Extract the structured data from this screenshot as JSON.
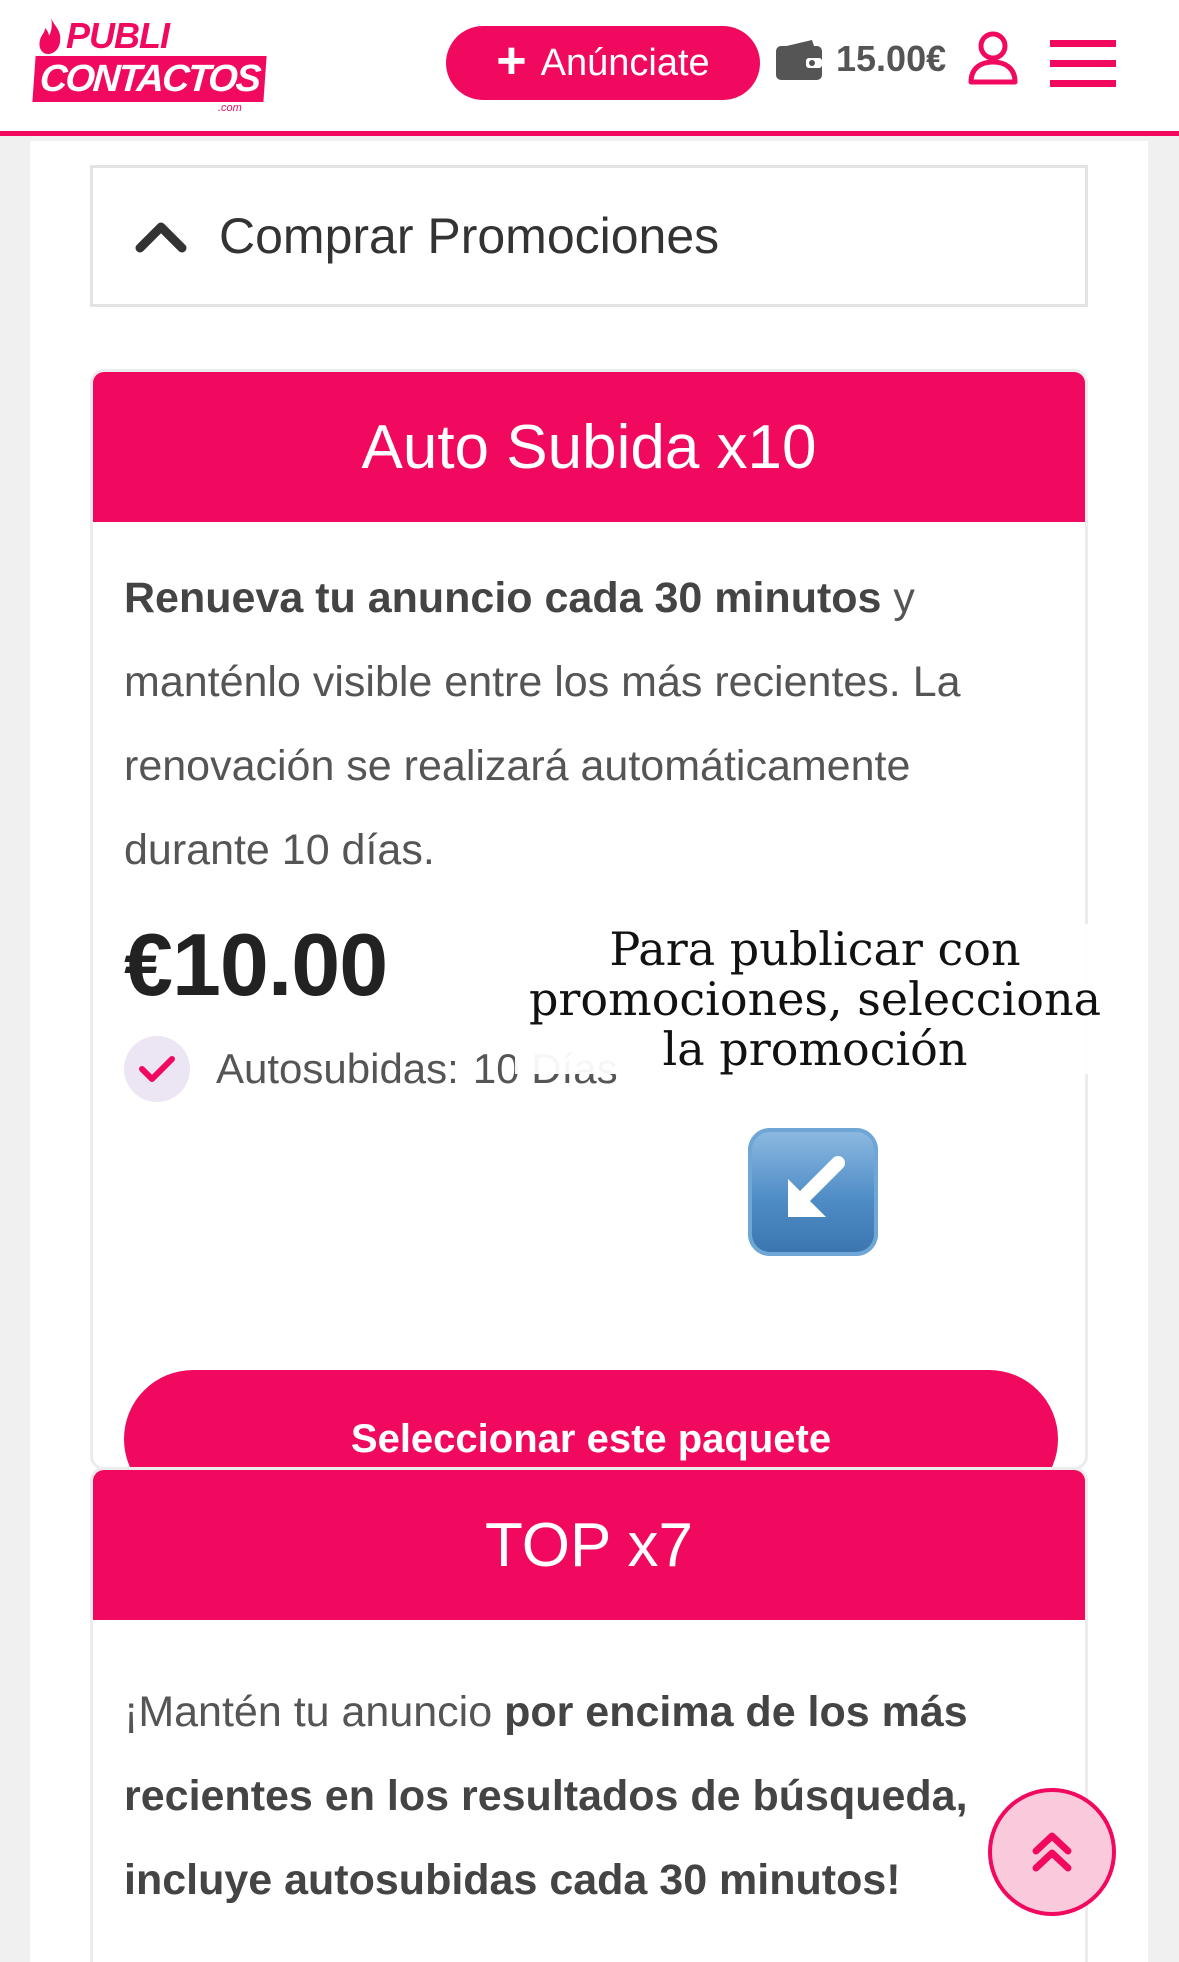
{
  "header": {
    "logo": {
      "line1": "PUBLI",
      "line2": "CONTACTOS",
      "suffix": ".com"
    },
    "anunciate_label": "Anúnciate",
    "balance": "15.00€"
  },
  "accordion": {
    "title": "Comprar Promociones"
  },
  "packages": [
    {
      "title": "Auto Subida x10",
      "desc_bold": "Renueva tu anuncio cada 30 minutos",
      "desc_rest": " y manténlo visible entre los más recientes. La renovación se realizará automáticamente durante 10 días.",
      "price": "€10.00",
      "feature_label": "Autosubidas:",
      "feature_value": "10 Días",
      "button_label": "Seleccionar este paquete"
    },
    {
      "title": "TOP x7",
      "desc_plain": "¡Mantén tu anuncio ",
      "desc_bold": "por encima de los más recientes en los resultados de búsqueda, incluye autosubidas cada 30 minutos!"
    }
  ],
  "overlay": {
    "text": "Para publicar con promociones, selecciona la promoción",
    "emoji": "arrow-down-left-icon"
  },
  "colors": {
    "brand": "#f0095e"
  }
}
